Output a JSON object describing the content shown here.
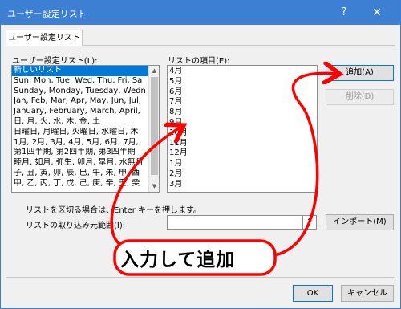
{
  "window": {
    "title": "ユーザー設定リスト",
    "help_glyph": "?",
    "close_glyph": "✕"
  },
  "tab": {
    "label": "ユーザー設定リスト"
  },
  "custom_lists": {
    "label": "ユーザー設定リスト(L):",
    "items": [
      "新しいリスト",
      "Sun, Mon, Tue, Wed, Thu, Fri, Sa",
      "Sunday, Monday, Tuesday, Wedn",
      "Jan, Feb, Mar, Apr, May, Jun, Jul,",
      "January, February, March, April,",
      "日, 月, 火, 水, 木, 金, 土",
      "日曜日, 月曜日, 火曜日, 水曜日, 木",
      "1月, 2月, 3月, 4月, 5月, 6月, 7月,",
      "第1四半期, 第2四半期, 第3四半期",
      "睦月, 如月, 弥生, 卯月, 皐月, 水無月",
      "子, 丑, 寅, 卯, 辰, 巳, 午, 未, 申, 酉",
      "甲, 乙, 丙, 丁, 戊, 己, 庚, 辛, 壬, 癸"
    ],
    "selected_index": 0
  },
  "list_entries": {
    "label": "リストの項目(E):",
    "items": [
      "4月",
      "5月",
      "6月",
      "7月",
      "8月",
      "9月",
      "10月",
      "11月",
      "12月",
      "1月",
      "2月",
      "3月"
    ]
  },
  "buttons": {
    "add": "追加(A)",
    "delete": "削除(D)",
    "import": "インポート(M)",
    "ok": "OK",
    "cancel": "キャンセル"
  },
  "separator_note": "リストを区切る場合は、Enter キーを押します。",
  "import_range": {
    "label": "リストの取り込み元範囲(I):",
    "value": "",
    "collapse_glyph": "↑"
  },
  "annotation": {
    "text": "入力して追加",
    "color": "#ff0000"
  }
}
